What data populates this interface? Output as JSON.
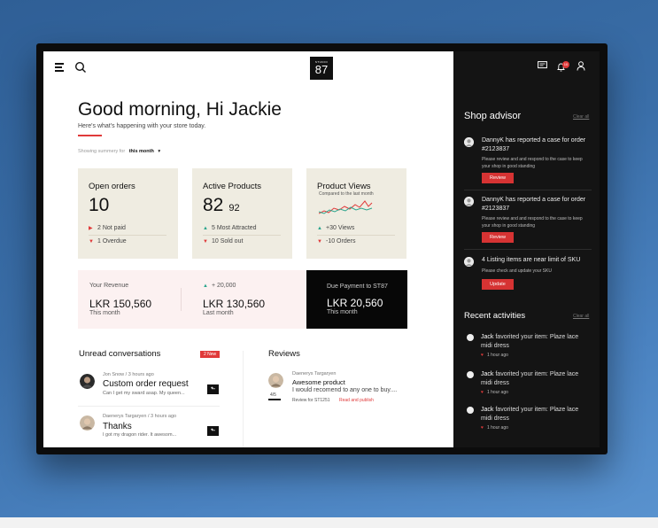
{
  "header": {
    "logo_small": "STUDIO",
    "logo_big": "87",
    "notification_count": "10"
  },
  "greeting": {
    "title": "Good morning, Hi Jackie",
    "subtitle": "Here's what's happening with your store today."
  },
  "summary": {
    "label": "Showing summery for",
    "period": "this month",
    "caret": "▾"
  },
  "cards": {
    "orders": {
      "title": "Open orders",
      "value": "10",
      "rows": [
        {
          "marker": "▶",
          "text": "2 Not paid"
        },
        {
          "marker": "▼",
          "text": "1 Overdue"
        }
      ]
    },
    "products": {
      "title": "Active Products",
      "value": "82",
      "secondary": "92",
      "rows": [
        {
          "marker": "▲",
          "text": "5 Most Attracted"
        },
        {
          "marker": "▼",
          "text": "10 Sold out"
        }
      ]
    },
    "views": {
      "title": "Product Views",
      "subtitle": "Compared to the last month",
      "rows": [
        {
          "marker": "▲",
          "text": "+30 Views"
        },
        {
          "marker": "▼",
          "text": "-10 Orders"
        }
      ],
      "line_colors": {
        "current": "#e03a3a",
        "previous": "#2ca58d"
      }
    }
  },
  "revenue": {
    "label": "Your Revenue",
    "current": "LKR 150,560",
    "current_sub": "This month",
    "change": "+ 20,000",
    "change_marker": "▲",
    "last": "LKR 130,560",
    "last_sub": "Last month",
    "due_label": "Due Payment to ST87",
    "due_value": "LKR 20,560",
    "due_sub": "This month"
  },
  "conversations": {
    "title": "Unread conversations",
    "badge": "2 New",
    "items": [
      {
        "meta": "Jon Snow / 3 hours ago",
        "title": "Custom order request",
        "message": "Can I get my sward asap. My queen..."
      },
      {
        "meta": "Daenerys Targaryen / 3 hours ago",
        "title": "Thanks",
        "message": "I got my dragon rider. It awesom..."
      }
    ]
  },
  "reviews": {
    "title": "Reviews",
    "items": [
      {
        "meta": "Daenerys Targaryen",
        "title": "Awesome product",
        "message": "I would recomend to any one to buy....",
        "rating": "4/5",
        "sku": "Review for ST1251",
        "action": "Read and publish"
      }
    ]
  },
  "advisor": {
    "title": "Shop advisor",
    "clear": "Clear all",
    "items": [
      {
        "title": "DannyK has reported a case for order #2123837",
        "desc": "Please review and and respond to the case to keep your shop in good standing",
        "button": "Review"
      },
      {
        "title": "DannyK has reported a case for order #2123837",
        "desc": "Please review and and respond to the case to keep your shop in good standing",
        "button": "Review"
      },
      {
        "title": "4 Listing items are near limit of SKU",
        "desc": "Please check and update your SKU",
        "button": "Update"
      }
    ]
  },
  "activities": {
    "title": "Recent activities",
    "clear": "Clear all",
    "items": [
      {
        "name": "Jack",
        "text": " favorited your item: Plaze lace midi dress",
        "time": "1 hour ago"
      },
      {
        "name": "Jack",
        "text": " favorited your item: Plaze lace midi dress",
        "time": "1 hour ago"
      },
      {
        "name": "Jack",
        "text": " favorited your item: Plaze lace midi dress",
        "time": "1 hour ago"
      }
    ]
  },
  "colors": {
    "accent": "#e03a3a",
    "positive": "#2ca58d",
    "card_bg": "#efece1",
    "sidebar_bg": "#141414"
  }
}
